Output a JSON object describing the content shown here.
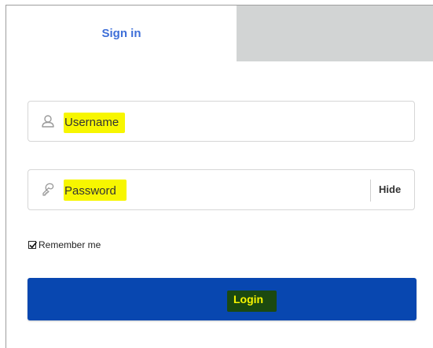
{
  "tabs": {
    "signin_label": "Sign in"
  },
  "username": {
    "placeholder": "Username",
    "value": ""
  },
  "password": {
    "placeholder": "Password",
    "value": "",
    "toggle_label": "Hide"
  },
  "remember": {
    "label": "Remember me",
    "checked": true
  },
  "login": {
    "label": "Login"
  },
  "icons": {
    "username": "user-icon",
    "password": "key-icon",
    "remember": "checkmark-icon"
  },
  "colors": {
    "tab_active_text": "#3e6fd8",
    "tab_inactive_bg": "#d2d4d4",
    "button_bg": "#0847b0",
    "highlight_yellow": "#f7f600",
    "login_highlight_bg": "#1b4910"
  }
}
